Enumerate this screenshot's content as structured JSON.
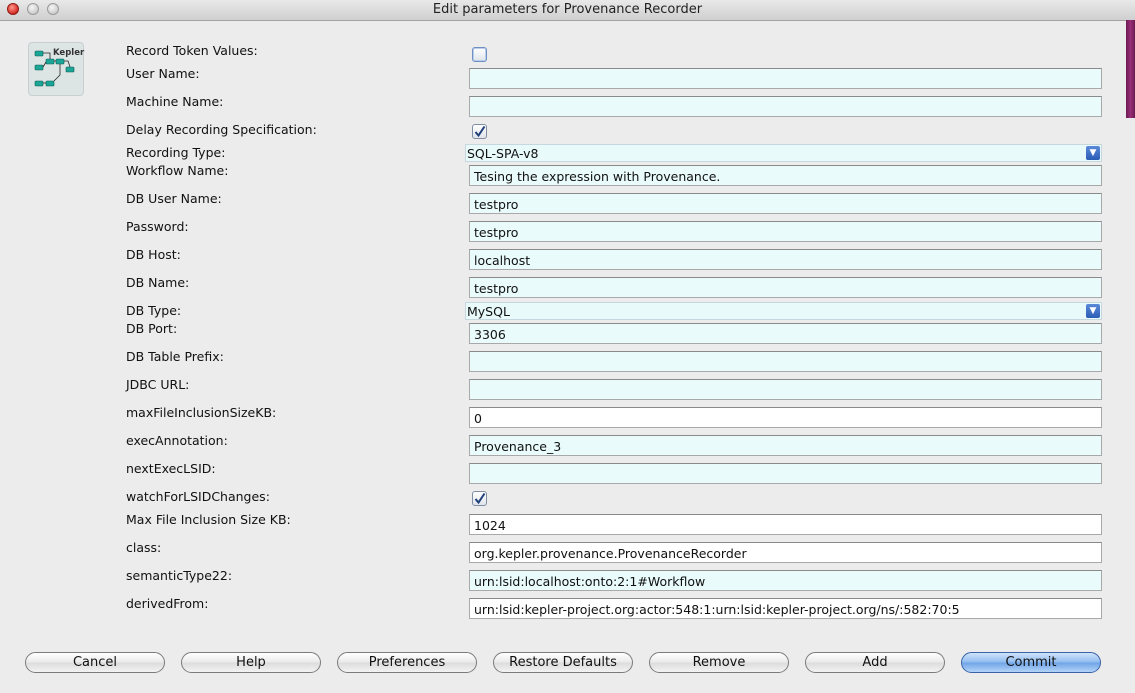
{
  "window": {
    "title": "Edit parameters for Provenance Recorder"
  },
  "logo": {
    "text": "Kepler"
  },
  "params": {
    "record_token_values": {
      "label": "Record Token Values:",
      "checked": false
    },
    "user_name": {
      "label": "User Name:",
      "value": ""
    },
    "machine_name": {
      "label": "Machine Name:",
      "value": ""
    },
    "delay_recording": {
      "label": "Delay Recording Specification:",
      "checked": true
    },
    "recording_type": {
      "label": "Recording Type:",
      "value": "SQL-SPA-v8"
    },
    "workflow_name": {
      "label": "Workflow Name:",
      "value": "Tesing the expression with Provenance."
    },
    "db_user_name": {
      "label": "DB User Name:",
      "value": "testpro"
    },
    "password": {
      "label": "Password:",
      "value": "testpro"
    },
    "db_host": {
      "label": "DB Host:",
      "value": "localhost"
    },
    "db_name": {
      "label": "DB Name:",
      "value": "testpro"
    },
    "db_type": {
      "label": "DB Type:",
      "value": "MySQL"
    },
    "db_port": {
      "label": "DB Port:",
      "value": "3306"
    },
    "db_table_prefix": {
      "label": "DB Table Prefix:",
      "value": ""
    },
    "jdbc_url": {
      "label": "JDBC URL:",
      "value": ""
    },
    "max_file_inclusion_size_kb_lower": {
      "label": "maxFileInclusionSizeKB:",
      "value": "0"
    },
    "exec_annotation": {
      "label": "execAnnotation:",
      "value": "Provenance_3"
    },
    "next_exec_lsid": {
      "label": "nextExecLSID:",
      "value": ""
    },
    "watch_for_lsid_changes": {
      "label": "watchForLSIDChanges:",
      "checked": true
    },
    "max_file_inclusion_size_kb": {
      "label": "Max File Inclusion Size KB:",
      "value": "1024"
    },
    "class": {
      "label": "class:",
      "value": "org.kepler.provenance.ProvenanceRecorder"
    },
    "semantic_type22": {
      "label": "semanticType22:",
      "value": "urn:lsid:localhost:onto:2:1#Workflow"
    },
    "derived_from": {
      "label": "derivedFrom:",
      "value": "urn:lsid:kepler-project.org:actor:548:1:urn:lsid:kepler-project.org/ns/:582:70:5"
    }
  },
  "buttons": {
    "cancel": "Cancel",
    "help": "Help",
    "preferences": "Preferences",
    "restore_defaults": "Restore Defaults",
    "remove": "Remove",
    "add": "Add",
    "commit": "Commit"
  },
  "colors": {
    "field_bg": "#e9fbfb",
    "primary_button": "#8fbbef",
    "close_button": "#d9302a"
  }
}
